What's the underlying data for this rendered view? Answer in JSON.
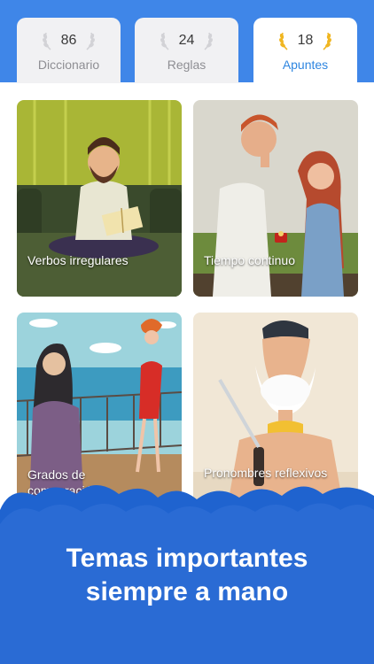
{
  "tabs": [
    {
      "count": "86",
      "label": "Diccionario",
      "active": false
    },
    {
      "count": "24",
      "label": "Reglas",
      "active": false
    },
    {
      "count": "18",
      "label": "Apuntes",
      "active": true
    }
  ],
  "cards": [
    {
      "title": "Verbos irregulares"
    },
    {
      "title": "Tiempo continuo"
    },
    {
      "title_line1": "Grados de",
      "title_line2": "comparación"
    },
    {
      "title": "Pronombres reflexivos"
    }
  ],
  "banner": {
    "line1": "Temas importantes",
    "line2": "siempre a mano"
  },
  "colors": {
    "brand_blue": "#3f86e8",
    "active_tab_text": "#2f86e0",
    "banner_blue": "#1f63cf",
    "wreath_gold": "#f0b621",
    "wreath_grey": "#d2d2d6"
  },
  "icons": {
    "tab_badge": "laurel-wreath-icon"
  }
}
